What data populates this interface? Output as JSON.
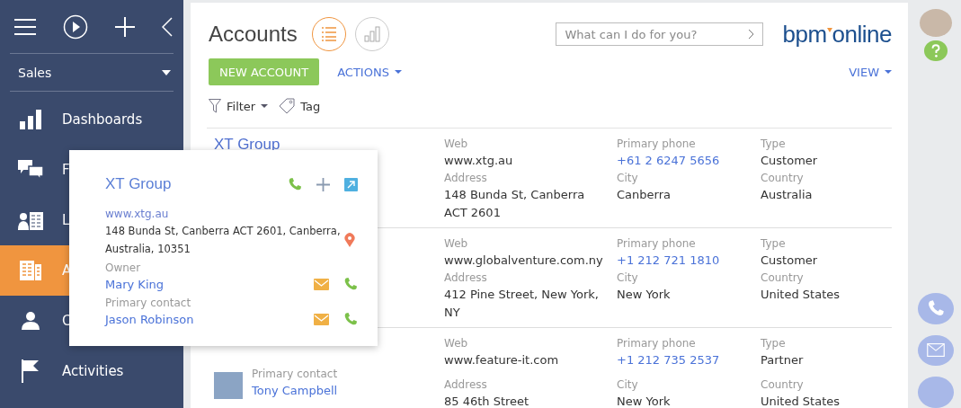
{
  "sidebar": {
    "workplace": "Sales",
    "items": [
      {
        "label": "Dashboards",
        "kind": "dashboards",
        "selected": false
      },
      {
        "label": "F",
        "kind": "feed",
        "selected": false
      },
      {
        "label": "L",
        "kind": "leads",
        "selected": false
      },
      {
        "label": "A",
        "kind": "accounts",
        "selected": true
      },
      {
        "label": "C",
        "kind": "contacts",
        "selected": false
      },
      {
        "label": "Activities",
        "kind": "activities",
        "selected": false
      }
    ]
  },
  "header": {
    "title": "Accounts",
    "views": [
      {
        "kind": "list",
        "selected": true
      },
      {
        "kind": "chart",
        "selected": false
      }
    ],
    "search": {
      "placeholder": "What can I do for you?"
    },
    "logo": {
      "left": "bpm",
      "right": "online"
    }
  },
  "toolbar": {
    "new_button": "NEW ACCOUNT",
    "actions": "ACTIONS",
    "view": "VIEW",
    "filter": "Filter",
    "tag": "Tag"
  },
  "rows": [
    {
      "name": "XT Group",
      "fields": [
        {
          "label": "Web",
          "value": "www.xtg.au",
          "kind": "text"
        },
        {
          "label": "Primary phone",
          "value": "+61 2 6247 5656",
          "kind": "link"
        },
        {
          "label": "Type",
          "value": "Customer",
          "kind": "text"
        },
        {
          "label": "Address",
          "value": "148 Bunda St, Canberra ACT 2601",
          "kind": "text"
        },
        {
          "label": "City",
          "value": "Canberra",
          "kind": "text"
        },
        {
          "label": "Country",
          "value": "Australia",
          "kind": "text"
        }
      ]
    },
    {
      "fields": [
        {
          "label": "Web",
          "value": "www.globalventure.com.ny",
          "kind": "text"
        },
        {
          "label": "Primary phone",
          "value": "+1 212 721 1810",
          "kind": "link"
        },
        {
          "label": "Type",
          "value": "Customer",
          "kind": "text"
        },
        {
          "label": "Address",
          "value": "412 Pine Street, New York, NY",
          "kind": "text"
        },
        {
          "label": "City",
          "value": "New York",
          "kind": "text"
        },
        {
          "label": "Country",
          "value": "United States",
          "kind": "text"
        }
      ]
    },
    {
      "contact": {
        "label": "Primary contact",
        "name": "Tony Campbell"
      },
      "fields": [
        {
          "label": "Web",
          "value": "www.feature-it.com",
          "kind": "text"
        },
        {
          "label": "Primary phone",
          "value": "+1 212 735 2537",
          "kind": "link"
        },
        {
          "label": "Type",
          "value": "Partner",
          "kind": "text"
        },
        {
          "label": "Address",
          "value": "85 46th Street",
          "kind": "text"
        },
        {
          "label": "City",
          "value": "New York",
          "kind": "text"
        },
        {
          "label": "Country",
          "value": "United States",
          "kind": "text"
        }
      ]
    }
  ],
  "popup": {
    "title": "XT Group",
    "web": "www.xtg.au",
    "address": "148 Bunda St, Canberra ACT 2601, Canberra, Australia, 10351",
    "people": [
      {
        "label": "Owner",
        "name": "Mary King"
      },
      {
        "label": "Primary contact",
        "name": "Jason Robinson"
      }
    ]
  }
}
